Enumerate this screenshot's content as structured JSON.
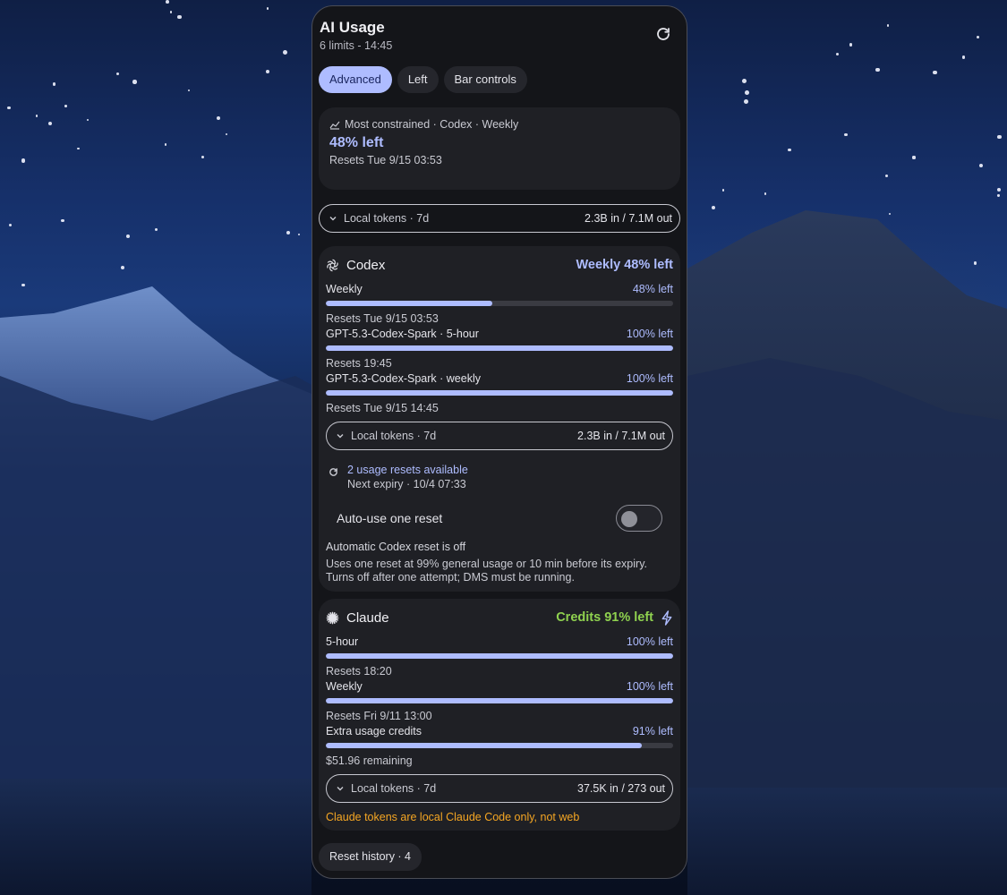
{
  "widget": {
    "title": "AI Usage",
    "subtitle": "6 limits - 14:45"
  },
  "tabs": [
    {
      "label": "Advanced",
      "active": true
    },
    {
      "label": "Left",
      "active": false
    },
    {
      "label": "Bar controls",
      "active": false
    }
  ],
  "summary": {
    "heading": "Most constrained · Codex · Weekly",
    "percent": "48% left",
    "reset": "Resets Tue 9/15 03:53"
  },
  "global_tokens": {
    "label": "Local tokens · 7d",
    "value": "2.3B in / 7.1M out"
  },
  "codex": {
    "name": "Codex",
    "status": "Weekly 48% left",
    "limits": [
      {
        "name": "Weekly",
        "pct_label": "48% left",
        "fraction": 0.48,
        "reset": "Resets Tue 9/15 03:53"
      },
      {
        "name": "GPT-5.3-Codex-Spark · 5-hour",
        "pct_label": "100% left",
        "fraction": 1.0,
        "reset": "Resets 19:45"
      },
      {
        "name": "GPT-5.3-Codex-Spark · weekly",
        "pct_label": "100% left",
        "fraction": 1.0,
        "reset": "Resets Tue 9/15 14:45"
      }
    ],
    "tokens": {
      "label": "Local tokens · 7d",
      "value": "2.3B in / 7.1M out"
    },
    "resets_available": "2 usage resets available",
    "next_expiry": "Next expiry · 10/4 07:33",
    "auto_label": "Auto-use one reset",
    "auto_enabled": false,
    "auto_status": "Automatic Codex reset is off",
    "auto_desc": "Uses one reset at 99% general usage or 10 min before its expiry. Turns off after one attempt; DMS must be running."
  },
  "claude": {
    "name": "Claude",
    "status": "Credits 91% left",
    "limits": [
      {
        "name": "5-hour",
        "pct_label": "100% left",
        "fraction": 1.0,
        "reset": "Resets 18:20"
      },
      {
        "name": "Weekly",
        "pct_label": "100% left",
        "fraction": 1.0,
        "reset": "Resets Fri 9/11 13:00"
      },
      {
        "name": "Extra usage credits",
        "pct_label": "91% left",
        "fraction": 0.91,
        "reset": "$51.96 remaining"
      }
    ],
    "tokens": {
      "label": "Local tokens · 7d",
      "value": "37.5K in / 273 out"
    },
    "note": "Claude tokens are local Claude Code only, not web"
  },
  "history": {
    "label": "Reset history · 4"
  },
  "colors": {
    "accent": "#aebcff",
    "green": "#8fd14f",
    "warning": "#f5a623",
    "panel": "#141519",
    "card": "#1f2025"
  }
}
